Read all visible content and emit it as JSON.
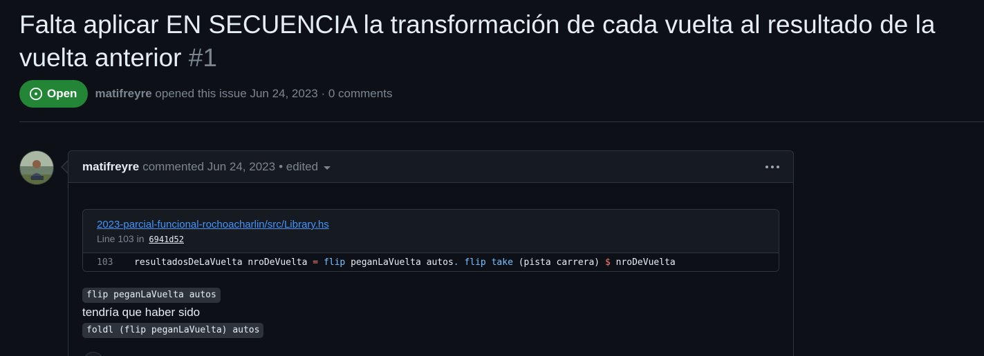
{
  "issue": {
    "title_line1": "Falta aplicar EN SECUENCIA la transformación de cada vuelta al resultado de la",
    "title_line2": "vuelta anterior",
    "number": "#1",
    "state": "Open",
    "author": "matifreyre",
    "opened_text": "opened this issue Jun 24, 2023 · 0 comments"
  },
  "comment": {
    "author": "matifreyre",
    "commented_text": "commented Jun 24, 2023",
    "edited_text": "• edited",
    "snippet": {
      "file_link": "2023-parcial-funcional-rochoacharlin/src/Library.hs",
      "line_label": "Line 103 in",
      "commit_sha": "6941d52",
      "line_number": "103",
      "code": {
        "t1": "resultadosDeLaVuelta nroDeVuelta ",
        "op1": "=",
        "sp1": " ",
        "fn1": "flip",
        "t2": " peganLaVuelta autos",
        "op2": ".",
        "sp2": " ",
        "fn2": "flip",
        "sp3": " ",
        "fn3": "take",
        "t3": " (pista carrera) ",
        "op3": "$",
        "t4": " nroDeVuelta"
      }
    },
    "code_before": "flip peganLaVuelta autos",
    "paragraph": "tendría que haber sido",
    "code_after": "foldl (flip peganLaVuelta) autos"
  },
  "colors": {
    "open_badge": "#238636",
    "link": "#4493f8",
    "background": "#0d1117"
  },
  "icons": [
    "issue-open-icon",
    "caret-down-icon",
    "kebab-menu-icon",
    "avatar"
  ]
}
